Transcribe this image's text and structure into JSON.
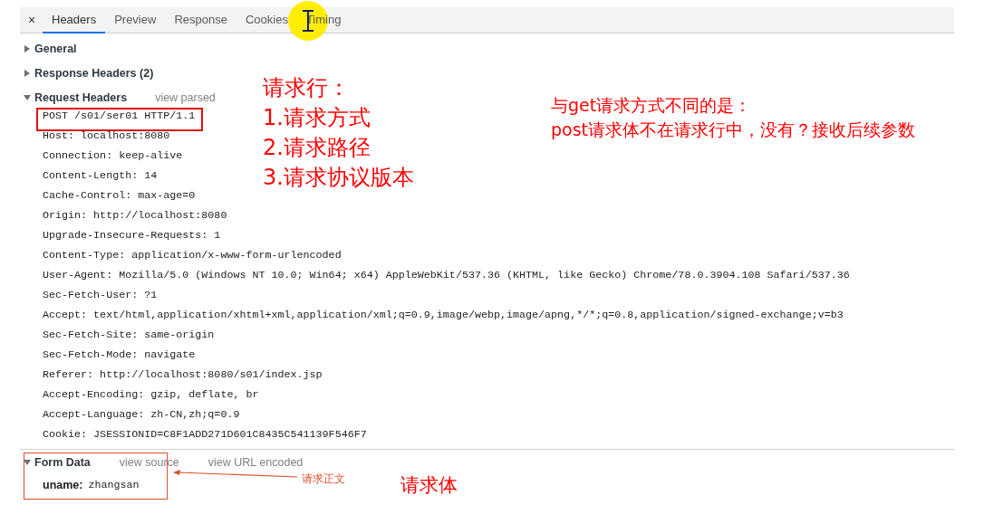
{
  "close_label": "×",
  "tabs": [
    {
      "label": "Headers",
      "selected": true
    },
    {
      "label": "Preview",
      "selected": false
    },
    {
      "label": "Response",
      "selected": false
    },
    {
      "label": "Cookies",
      "selected": false
    },
    {
      "label": "Timing",
      "selected": false
    }
  ],
  "sections": [
    {
      "title": "General",
      "expanded": false
    },
    {
      "title": "Response Headers (2)",
      "expanded": false
    },
    {
      "title": "Request Headers",
      "expanded": true,
      "links": [
        "view parsed"
      ],
      "lines": [
        "POST /s01/ser01 HTTP/1.1",
        "Host: localhost:8080",
        "Connection: keep-alive",
        "Content-Length: 14",
        "Cache-Control: max-age=0",
        "Origin: http://localhost:8080",
        "Upgrade-Insecure-Requests: 1",
        "Content-Type: application/x-www-form-urlencoded",
        "User-Agent: Mozilla/5.0 (Windows NT 10.0; Win64; x64) AppleWebKit/537.36 (KHTML, like Gecko) Chrome/78.0.3904.108 Safari/537.36",
        "Sec-Fetch-User: ?1",
        "Accept: text/html,application/xhtml+xml,application/xml;q=0.9,image/webp,image/apng,*/*;q=0.8,application/signed-exchange;v=b3",
        "Sec-Fetch-Site: same-origin",
        "Sec-Fetch-Mode: navigate",
        "Referer: http://localhost:8080/s01/index.jsp",
        "Accept-Encoding: gzip, deflate, br",
        "Accept-Language: zh-CN,zh;q=0.9",
        "Cookie: JSESSIONID=C8F1ADD271D601C8435C541139F546F7"
      ]
    },
    {
      "title": "Form Data",
      "expanded": true,
      "links": [
        "view source",
        "view URL encoded"
      ],
      "fields": [
        {
          "name": "uname:",
          "value": "zhangsan"
        }
      ]
    }
  ],
  "annotations": {
    "request_line_note": [
      "请求行：",
      "1.请求方式",
      "2.请求路径",
      "3.请求协议版本"
    ],
    "difference_note": [
      "与get请求方式不同的是：",
      "post请求体不在请求行中，没有？接收后续参数"
    ],
    "body_arrow_label": "请求正文",
    "body_note": "请求体"
  }
}
